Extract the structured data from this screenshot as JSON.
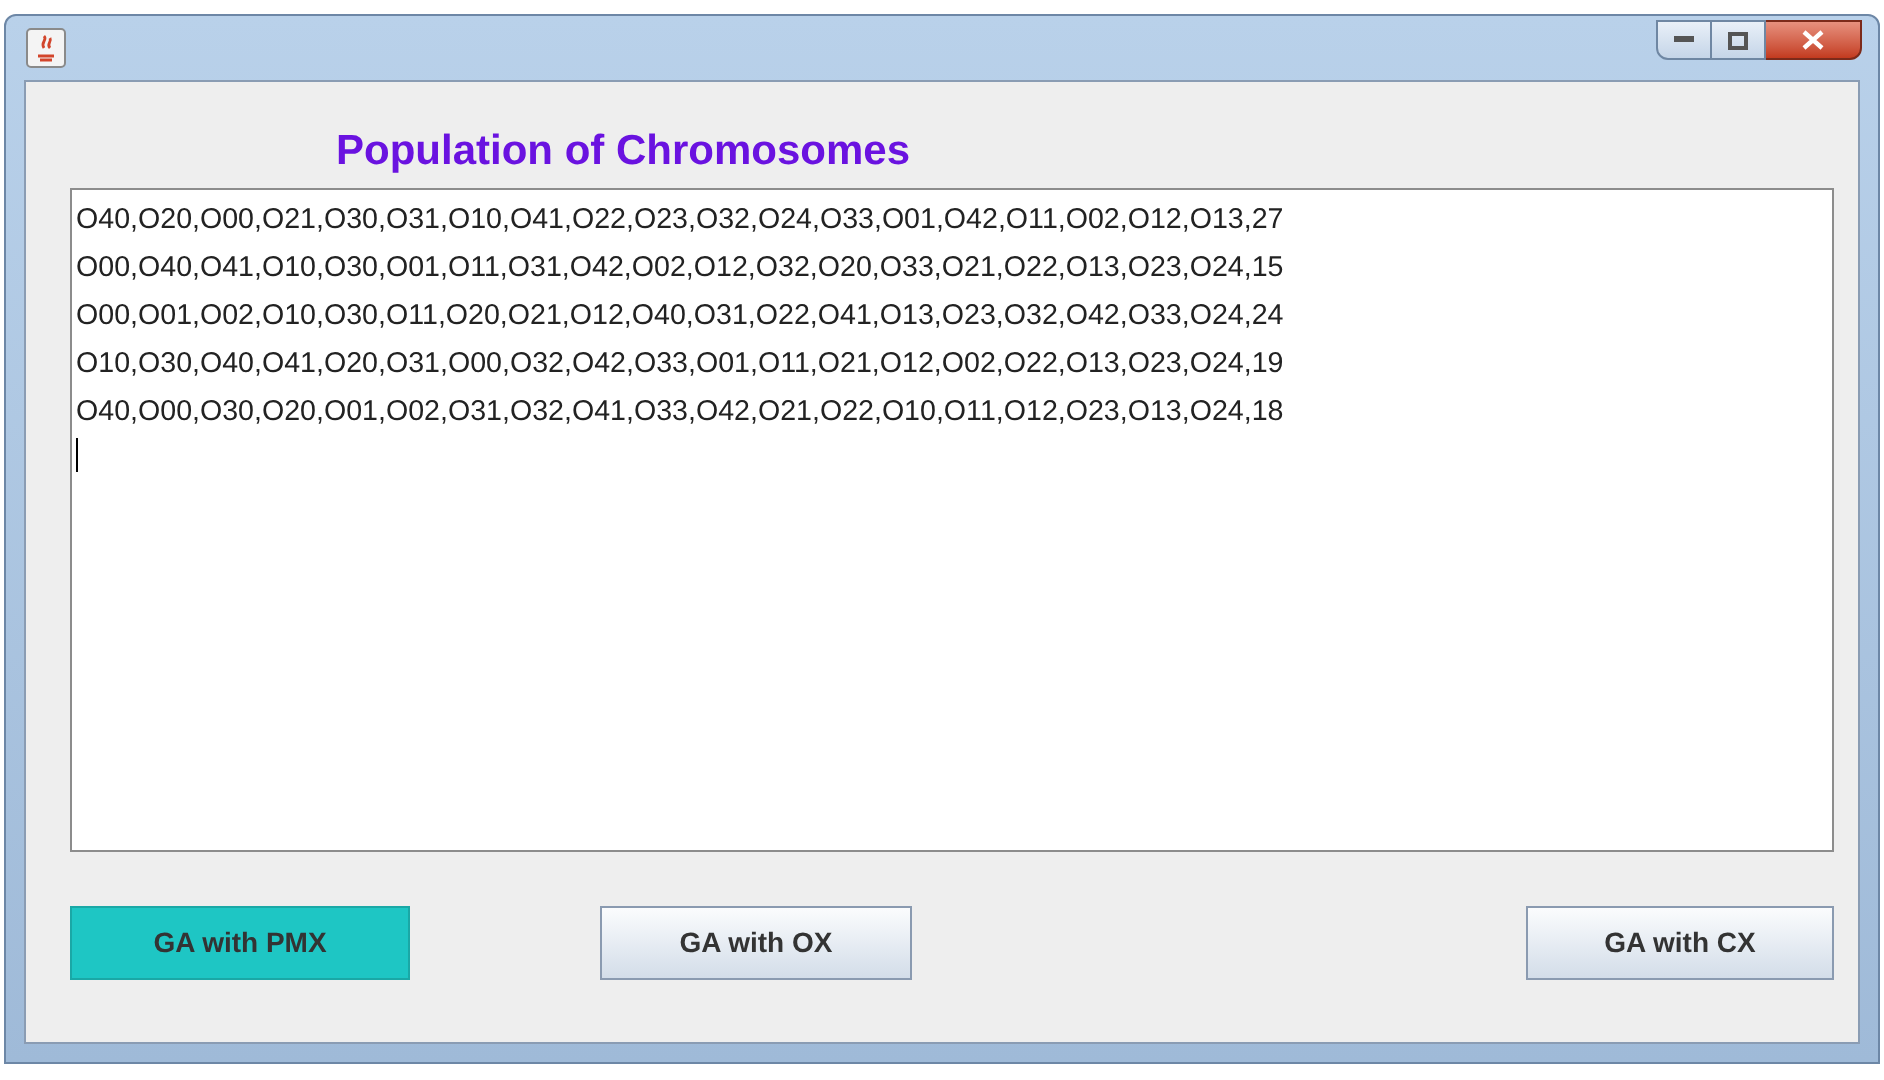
{
  "content": {
    "title": "Population of Chromosomes",
    "lines": [
      "O40,O20,O00,O21,O30,O31,O10,O41,O22,O23,O32,O24,O33,O01,O42,O11,O02,O12,O13,27",
      "O00,O40,O41,O10,O30,O01,O11,O31,O42,O02,O12,O32,O20,O33,O21,O22,O13,O23,O24,15",
      "O00,O01,O02,O10,O30,O11,O20,O21,O12,O40,O31,O22,O41,O13,O23,O32,O42,O33,O24,24",
      "O10,O30,O40,O41,O20,O31,O00,O32,O42,O33,O01,O11,O21,O12,O02,O22,O13,O23,O24,19",
      "O40,O00,O30,O20,O01,O02,O31,O32,O41,O33,O42,O21,O22,O10,O11,O12,O23,O13,O24,18"
    ]
  },
  "buttons": [
    {
      "label": "GA with PMX",
      "selected": true
    },
    {
      "label": "GA with OX",
      "selected": false
    },
    {
      "label": "GA with CX",
      "selected": false
    }
  ]
}
